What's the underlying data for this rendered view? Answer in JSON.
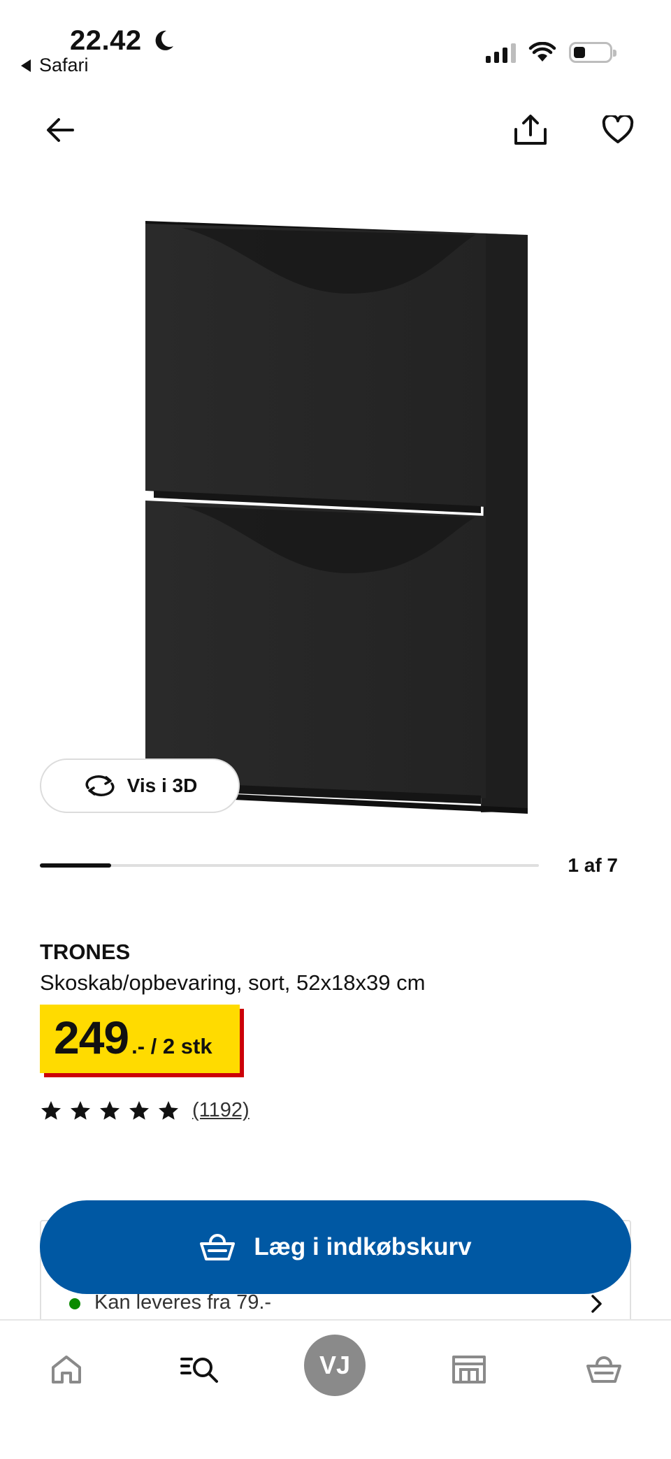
{
  "status_bar": {
    "time": "22.42",
    "back_app": "Safari"
  },
  "icons": {
    "back": "arrow-left-icon",
    "share": "share-icon",
    "favorite": "heart-icon",
    "rotate": "rotate-3d-icon",
    "cart": "shopping-basket-icon",
    "home": "home-icon",
    "search": "search-list-icon",
    "store": "store-icon",
    "basket": "basket-icon"
  },
  "gallery": {
    "view3d_label": "Vis i 3D",
    "counter": "1 af 7",
    "current": 1,
    "total": 7
  },
  "product": {
    "name": "TRONES",
    "description": "Skoskab/opbevaring, sort, 52x18x39 cm",
    "price": "249",
    "price_suffix": ".- / 2 stk",
    "rating": 5,
    "rating_count": "(1192)"
  },
  "delivery": {
    "text": "Kan leveres fra 79.-"
  },
  "cart_button": {
    "label": "Læg i indkøbskurv"
  },
  "tabbar": {
    "avatar_initials": "VJ"
  },
  "colors": {
    "price_yellow": "#ffdb00",
    "price_red": "#cc0008",
    "cta_blue": "#0058a3",
    "in_stock_green": "#0a8a00"
  }
}
